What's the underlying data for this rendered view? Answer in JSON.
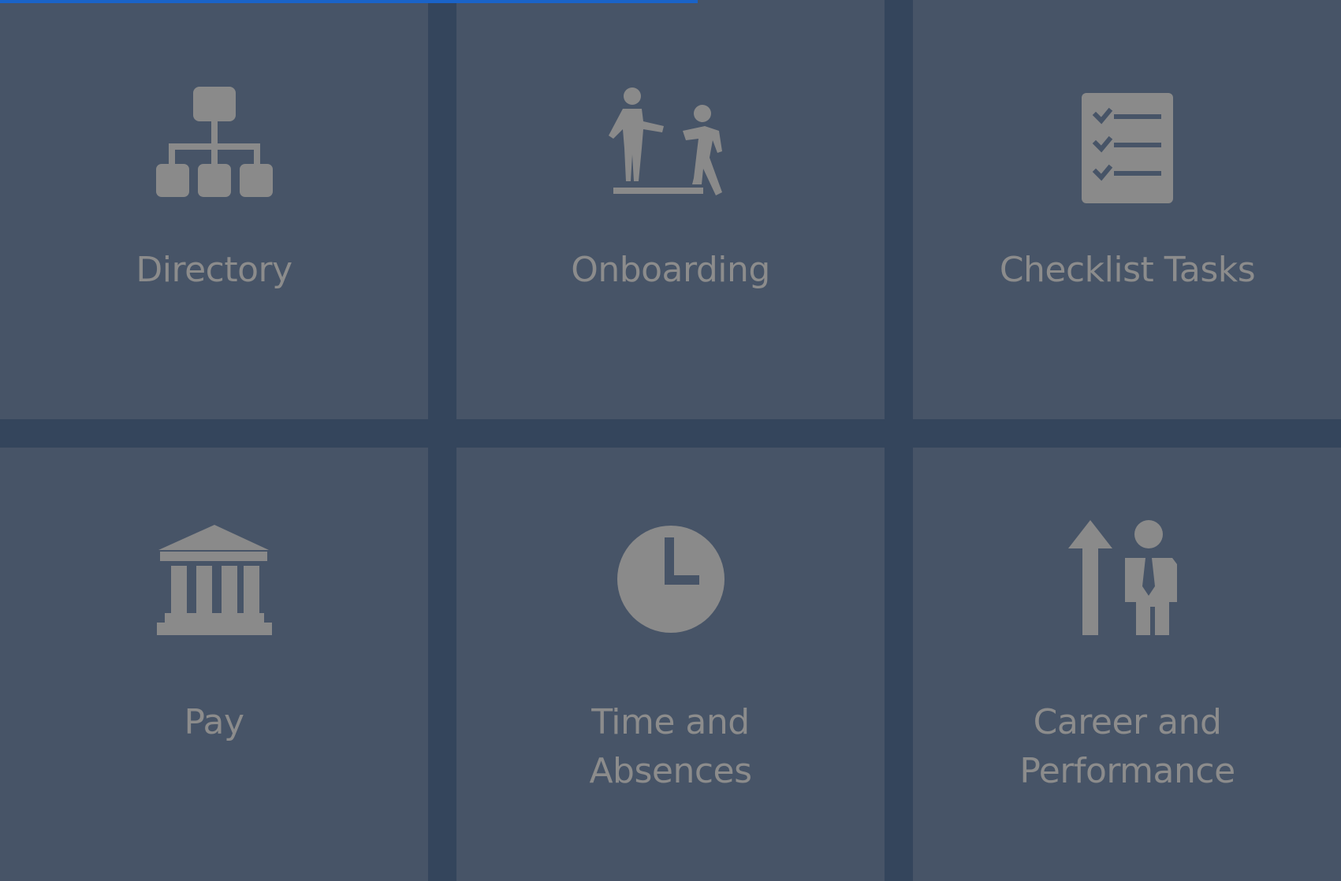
{
  "progress_percent": 52,
  "colors": {
    "background": "#34455c",
    "tile": "#475467",
    "icon": "#8a8a8a",
    "text": "#8c8c8c",
    "progress": "#1a63c8"
  },
  "tiles": [
    {
      "lines": [
        "Directory"
      ],
      "icon": "org-chart-icon"
    },
    {
      "lines": [
        "Onboarding"
      ],
      "icon": "onboarding-people-icon"
    },
    {
      "lines": [
        "Checklist Tasks"
      ],
      "icon": "checklist-icon"
    },
    {
      "lines": [
        "Pay"
      ],
      "icon": "bank-icon"
    },
    {
      "lines": [
        "Time and",
        "Absences"
      ],
      "icon": "clock-icon"
    },
    {
      "lines": [
        "Career and",
        "Performance"
      ],
      "icon": "career-growth-icon"
    }
  ]
}
